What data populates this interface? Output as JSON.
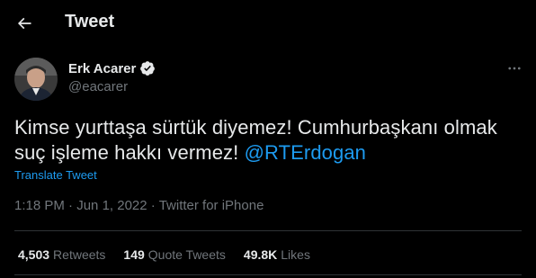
{
  "header": {
    "back_icon": "arrow-left-icon",
    "title": "Tweet"
  },
  "author": {
    "name": "Erk Acarer",
    "handle": "@eacarer",
    "verified_icon": "verified-badge-icon",
    "more_icon": "more-horizontal-icon"
  },
  "tweet": {
    "text": "Kimse yurttaşa sürtük diyemez! Cumhurbaşkanı olmak suç işleme hakkı vermez! ",
    "mention": "@RTErdogan",
    "translate_label": "Translate Tweet",
    "time": "1:18 PM",
    "separator": "·",
    "date": "Jun 1, 2022",
    "source": "Twitter for iPhone"
  },
  "stats": {
    "retweets_count": "4,503",
    "retweets_label": "Retweets",
    "quotes_count": "149",
    "quotes_label": "Quote Tweets",
    "likes_count": "49.8K",
    "likes_label": "Likes"
  },
  "colors": {
    "background": "#000000",
    "text_primary": "#e7e9ea",
    "text_secondary": "#71767b",
    "accent": "#1d9bf0",
    "divider": "#2f3336"
  }
}
